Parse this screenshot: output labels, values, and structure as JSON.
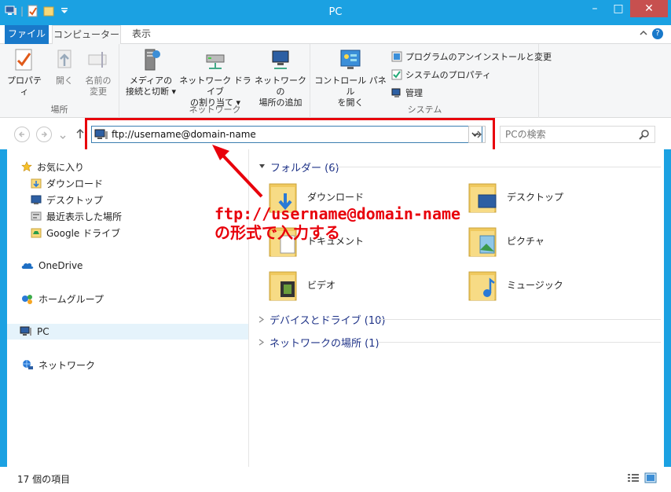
{
  "window": {
    "title": "PC",
    "controls": {
      "minimize": "–",
      "maximize": "□",
      "close": "✕"
    }
  },
  "ribbon": {
    "tabs": [
      "ファイル",
      "コンピューター",
      "表示"
    ],
    "help": "?",
    "groups": [
      {
        "label": "場所",
        "buttons": [
          {
            "line1": "プロパティ",
            "line2": "",
            "icon": "properties-icon"
          },
          {
            "line1": "開く",
            "line2": "",
            "icon": "open-icon"
          },
          {
            "line1": "名前の",
            "line2": "変更",
            "icon": "rename-icon"
          }
        ]
      },
      {
        "label": "ネットワーク",
        "buttons": [
          {
            "line1": "メディアの",
            "line2": "接続と切断 ▾",
            "icon": "media-server-icon"
          },
          {
            "line1": "ネットワーク ドライブ",
            "line2": "の割り当て ▾",
            "icon": "map-drive-icon"
          },
          {
            "line1": "ネットワークの",
            "line2": "場所の追加",
            "icon": "add-network-location-icon"
          }
        ]
      },
      {
        "label": "システム",
        "buttons": [
          {
            "line1": "コントロール パネル",
            "line2": "を開く",
            "icon": "control-panel-icon"
          }
        ],
        "small": [
          {
            "label": "プログラムのアンインストールと変更",
            "icon": "uninstall-icon"
          },
          {
            "label": "システムのプロパティ",
            "icon": "system-properties-icon"
          },
          {
            "label": "管理",
            "icon": "manage-icon"
          }
        ]
      }
    ]
  },
  "address": {
    "value": "ftp://username@domain-name",
    "search_placeholder": "PCの検索"
  },
  "nav_pane": {
    "favorites": "お気に入り",
    "favorite_items": [
      "ダウンロード",
      "デスクトップ",
      "最近表示した場所",
      "Google ドライブ"
    ],
    "onedrive": "OneDrive",
    "homegroup": "ホームグループ",
    "pc": "PC",
    "network": "ネットワーク"
  },
  "main": {
    "folders_header": "フォルダー (6)",
    "folders": [
      "ダウンロード",
      "デスクトップ",
      "ドキュメント",
      "ピクチャ",
      "ビデオ",
      "ミュージック"
    ],
    "devices_header": "デバイスとドライブ (10)",
    "network_header": "ネットワークの場所 (1)"
  },
  "annotation": {
    "line1": "ftp://username@domain-name",
    "line2": "の形式で入力する",
    "color": "#e8000b"
  },
  "status": {
    "item_count": "17 個の項目"
  },
  "colors": {
    "titlebar": "#1ba1e2",
    "file_tab": "#1979ca",
    "close": "#c7504f",
    "group_header": "#1e3287"
  }
}
